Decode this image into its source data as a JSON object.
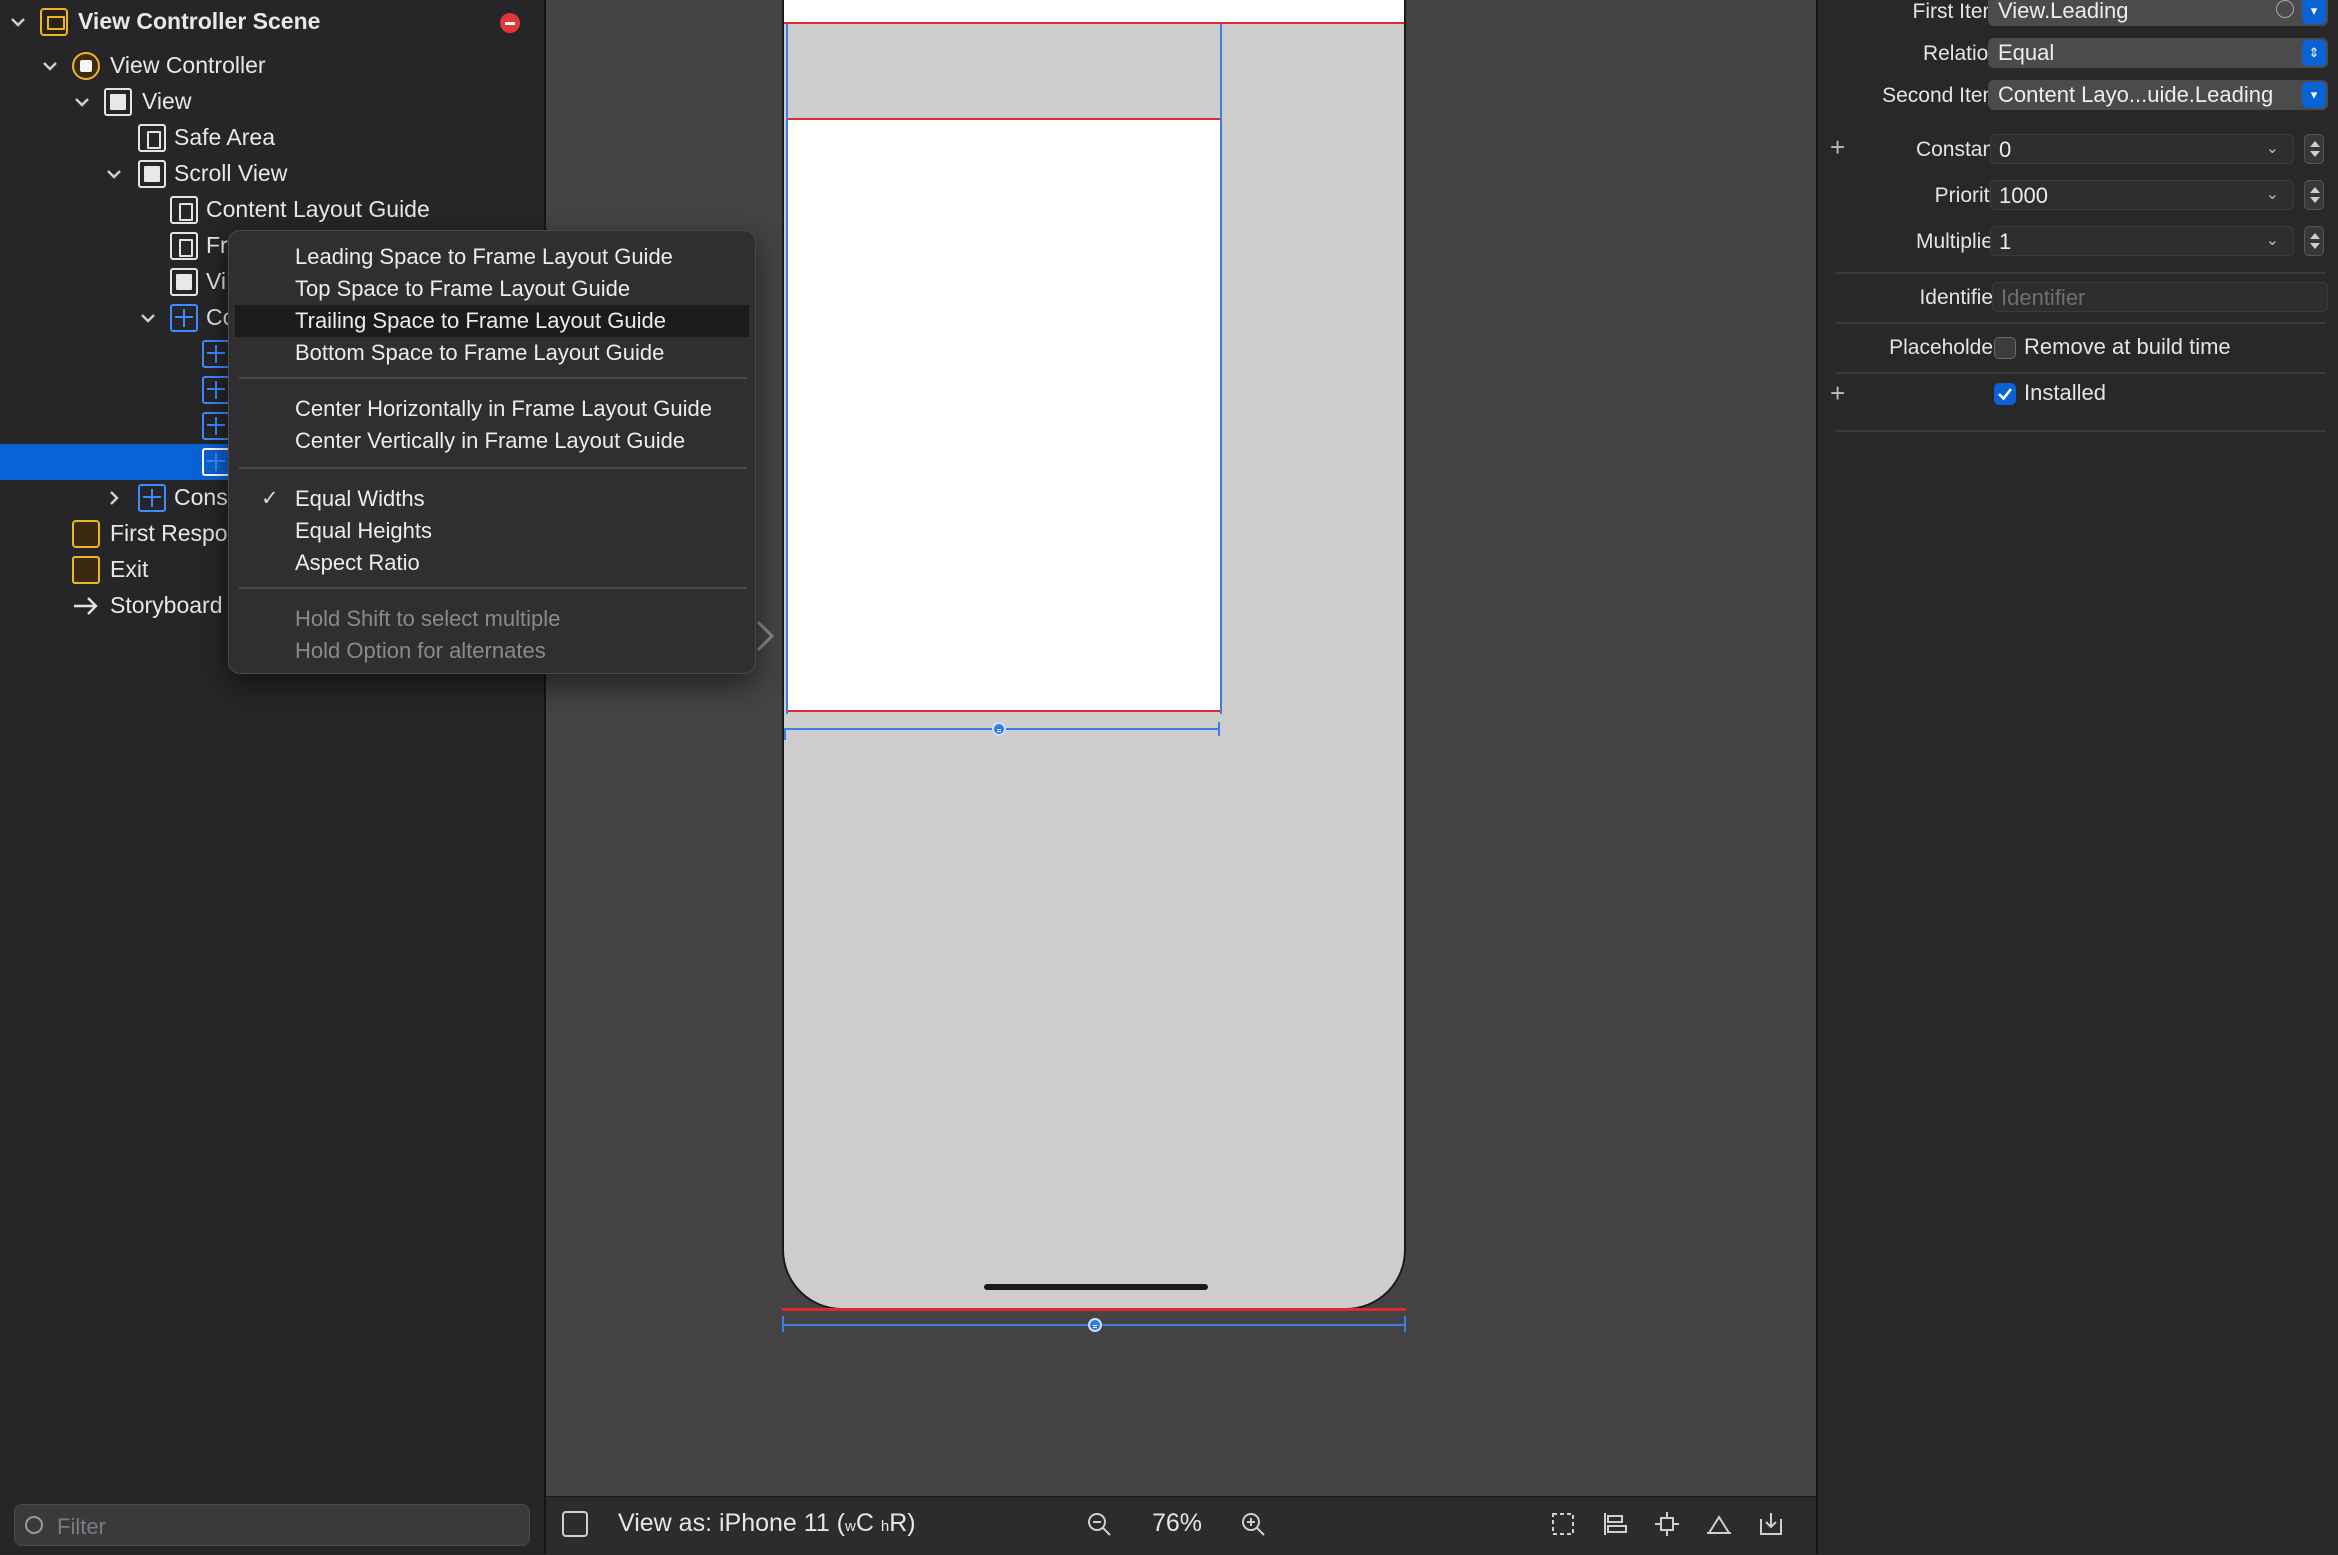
{
  "outline": {
    "rows": [
      {
        "label": "View Controller Scene"
      },
      {
        "label": "View Controller"
      },
      {
        "label": "View"
      },
      {
        "label": "Safe Area"
      },
      {
        "label": "Scroll View"
      },
      {
        "label": "Content Layout Guide"
      },
      {
        "label": "Fr"
      },
      {
        "label": "Vi"
      },
      {
        "label": "Co"
      },
      {
        "label": ""
      },
      {
        "label": ""
      },
      {
        "label": ""
      },
      {
        "label": ""
      },
      {
        "label": "Cons"
      },
      {
        "label": "First Respo"
      },
      {
        "label": "Exit"
      },
      {
        "label": "Storyboard"
      }
    ],
    "filter_placeholder": "Filter"
  },
  "menu": {
    "items": [
      {
        "label": "Leading Space to Frame Layout Guide"
      },
      {
        "label": "Top Space to Frame Layout Guide"
      },
      {
        "label": "Trailing Space to Frame Layout Guide"
      },
      {
        "label": "Bottom Space to Frame Layout Guide"
      },
      {
        "label": "Center Horizontally in Frame Layout Guide"
      },
      {
        "label": "Center Vertically in Frame Layout Guide"
      },
      {
        "label": "Equal Widths",
        "checked": true
      },
      {
        "label": "Equal Heights"
      },
      {
        "label": "Aspect Ratio"
      },
      {
        "label": "Hold Shift to select multiple"
      },
      {
        "label": "Hold Option for alternates"
      }
    ],
    "highlighted_index": 2
  },
  "canvas_bar": {
    "view_as": "View as: iPhone 11 (",
    "w": "w",
    "C": "C",
    "h": "h",
    "R": "R)",
    "zoom": "76%"
  },
  "inspector": {
    "first_item_label": "First Item",
    "first_item_value": "View.Leading",
    "relation_label": "Relation",
    "relation_value": "Equal",
    "second_item_label": "Second Item",
    "second_item_value": "Content Layo...uide.Leading",
    "constant_label": "Constant",
    "constant_value": "0",
    "priority_label": "Priority",
    "priority_value": "1000",
    "multiplier_label": "Multiplier",
    "multiplier_value": "1",
    "identifier_label": "Identifier",
    "identifier_placeholder": "Identifier",
    "placeholder_label": "Placeholder",
    "remove_at_build_label": "Remove at build time",
    "installed_label": "Installed",
    "installed_checked": true,
    "remove_checked": false
  },
  "colors": {
    "accent": "#0a63d6",
    "constraint_red": "#e02a2a",
    "constraint_blue": "#3d7fe0",
    "scene_icon": "#f0b429"
  }
}
